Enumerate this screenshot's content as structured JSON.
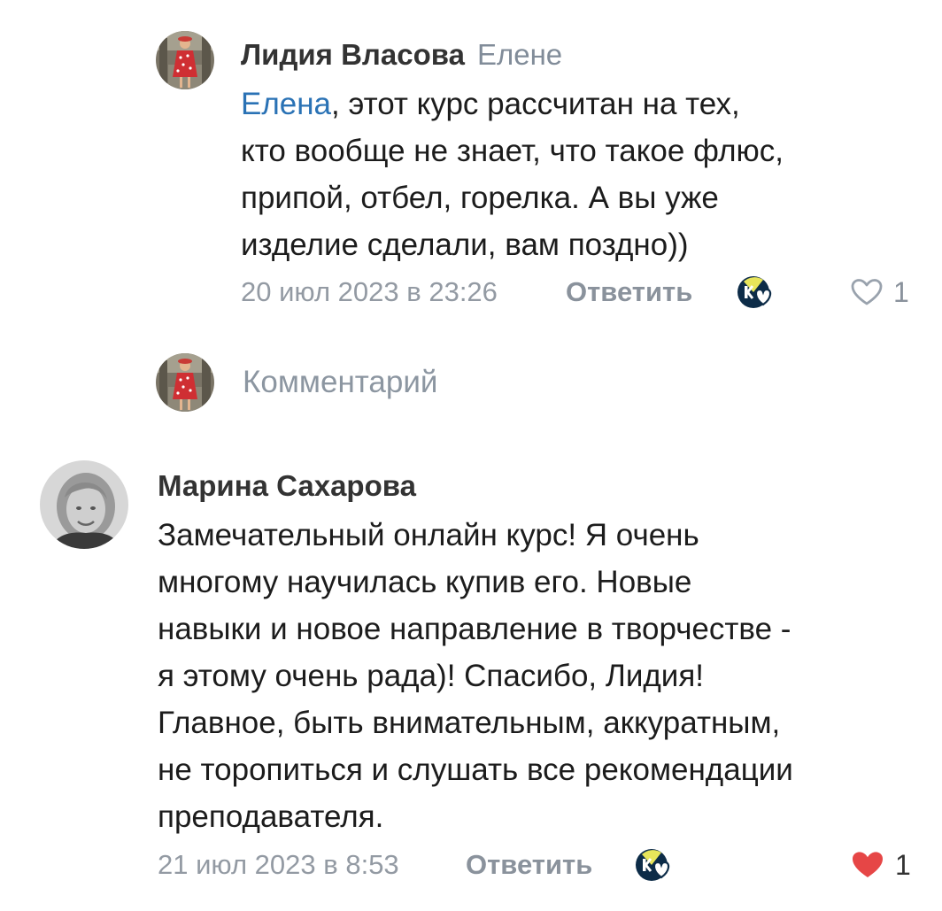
{
  "reply": {
    "author": "Лидия Власова",
    "reply_to": "Елене",
    "mention": "Елена",
    "lines": [
      ", этот курс рассчитан на тех,",
      "кто вообще не знает, что такое флюс,",
      "припой, отбел, горелка. А вы уже",
      "изделие сделали, вам поздно))"
    ],
    "date": "20 июл 2023 в 23:26",
    "reply_label": "Ответить",
    "likes": "1",
    "liked": false
  },
  "composer": {
    "placeholder": "Комментарий"
  },
  "comment": {
    "author": "Марина Сахарова",
    "lines": [
      "Замечательный онлайн курс! Я очень",
      "многому научилась купив его. Новые",
      "навыки и новое направление в творчестве -",
      "я этому очень рада)! Спасибо, Лидия!",
      "Главное, быть внимательным, аккуратным,",
      "не торопиться и слушать все рекомендации",
      "преподавателя."
    ],
    "date": "21 июл 2023 в 8:53",
    "reply_label": "Ответить",
    "likes": "1",
    "liked": true
  },
  "icons": {
    "like_outline": "heart-outline-icon",
    "like_filled": "heart-filled-icon",
    "reaction": "reaction-picker-icon"
  },
  "colors": {
    "mention": "#2a72b5",
    "secondary_text": "#939aa3",
    "like_active": "#e64646",
    "like_inactive": "#99a2ad"
  }
}
